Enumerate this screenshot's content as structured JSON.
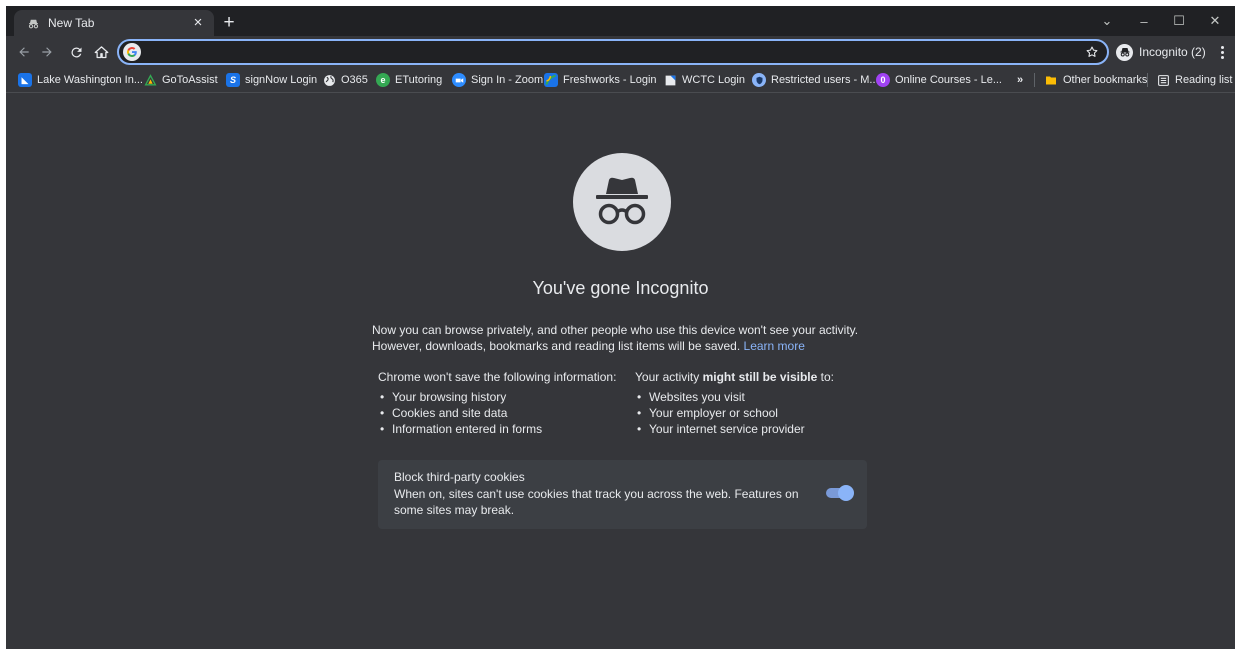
{
  "tab": {
    "title": "New Tab",
    "close": "×"
  },
  "new_tab": "+",
  "window": {
    "collapse": "⌄",
    "minimize": "–",
    "maximize": "☐",
    "close": "✕"
  },
  "toolbar": {
    "omnibox_value": "",
    "profile_label": "Incognito (2)"
  },
  "bookmarks": {
    "items": [
      {
        "label": "Lake Washington In...",
        "icon": "lwtech-icon",
        "color": "#1a73e8"
      },
      {
        "label": "GoToAssist",
        "icon": "gotoassist-icon",
        "color": "#34a853"
      },
      {
        "label": "signNow Login",
        "icon": "signnow-icon",
        "color": "#1a73e8"
      },
      {
        "label": "O365",
        "icon": "globe-icon",
        "color": "#e8eaed"
      },
      {
        "label": "ETutoring",
        "icon": "etutoring-icon",
        "color": "#34a853"
      },
      {
        "label": "Sign In - Zoom",
        "icon": "zoom-icon",
        "color": "#2d8cff"
      },
      {
        "label": "Freshworks - Login",
        "icon": "freshworks-icon",
        "color": "#1db954"
      },
      {
        "label": "WCTC Login",
        "icon": "wctc-icon",
        "color": "#e8eaed"
      },
      {
        "label": "Restricted users - M...",
        "icon": "shield-icon",
        "color": "#8ab4f8"
      },
      {
        "label": "Online Courses - Le...",
        "icon": "courses-icon",
        "color": "#a142f4"
      }
    ],
    "more": "»",
    "other": "Other bookmarks",
    "reading_list": "Reading list"
  },
  "page": {
    "heading": "You've gone Incognito",
    "intro_line1": "Now you can browse privately, and other people who use this device won't see your activity.",
    "intro_line2": "However, downloads, bookmarks and reading list items will be saved.",
    "learn_more": "Learn more",
    "left_title": "Chrome won't save the following information:",
    "left_items": [
      "Your browsing history",
      "Cookies and site data",
      "Information entered in forms"
    ],
    "right_title_a": "Your activity ",
    "right_title_b": "might still be visible",
    "right_title_c": " to:",
    "right_items": [
      "Websites you visit",
      "Your employer or school",
      "Your internet service provider"
    ],
    "cookie_title": "Block third-party cookies",
    "cookie_desc": "When on, sites can't use cookies that track you across the web. Features on some sites may break.",
    "cookie_toggle_on": true
  },
  "colors": {
    "accent": "#8ab4f8",
    "background": "#35363a",
    "tabstrip": "#202124"
  }
}
